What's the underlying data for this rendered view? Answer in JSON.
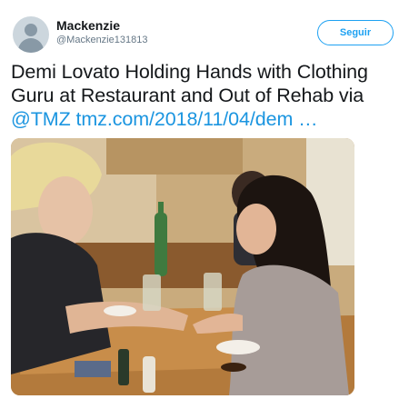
{
  "tweet": {
    "display_name": "Mackenzie",
    "handle": "@Mackenzie131813",
    "follow_label": "Seguir",
    "text_line1": "Demi Lovato Holding Hands with Clothing",
    "text_line2": "Guru at Restaurant and Out of Rehab  via",
    "mention": "@TMZ",
    "link_text": "tmz.com/2018/11/04/dem …"
  },
  "colors": {
    "accent": "#1da1f2",
    "link": "#1b95e0",
    "secondary_text": "#657786"
  },
  "icons": {
    "avatar": "default-profile-silhouette"
  }
}
